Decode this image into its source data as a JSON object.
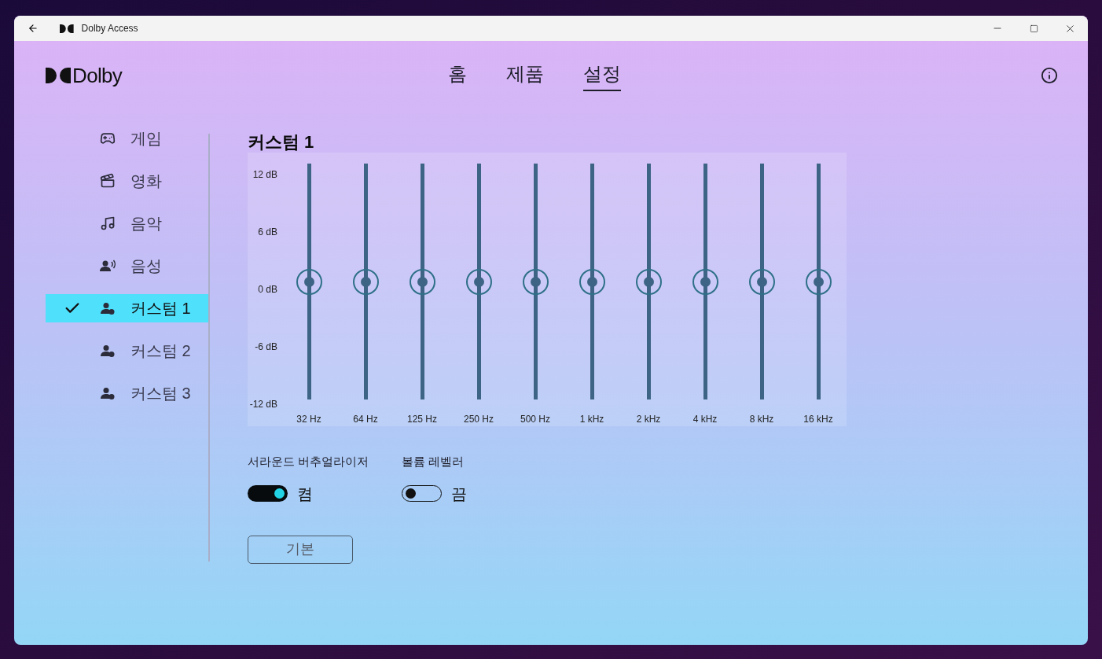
{
  "window": {
    "title": "Dolby Access"
  },
  "logo": {
    "text": "Dolby"
  },
  "nav": [
    {
      "label": "홈",
      "selected": false
    },
    {
      "label": "제품",
      "selected": false
    },
    {
      "label": "설정",
      "selected": true
    }
  ],
  "sidebar": {
    "items": [
      {
        "kind": "game",
        "label": "게임",
        "selected": false
      },
      {
        "kind": "movie",
        "label": "영화",
        "selected": false
      },
      {
        "kind": "music",
        "label": "음악",
        "selected": false
      },
      {
        "kind": "voice",
        "label": "음성",
        "selected": false
      },
      {
        "kind": "custom",
        "label": "커스텀 1",
        "selected": true
      },
      {
        "kind": "custom",
        "label": "커스텀 2",
        "selected": false
      },
      {
        "kind": "custom",
        "label": "커스텀 3",
        "selected": false
      }
    ]
  },
  "equalizer": {
    "title": "커스텀 1",
    "scale": [
      "12 dB",
      "6 dB",
      "0 dB",
      "-6 dB",
      "-12 dB"
    ],
    "bands": [
      {
        "label": "32 Hz",
        "level": 0.5
      },
      {
        "label": "64 Hz",
        "level": 0.5
      },
      {
        "label": "125 Hz",
        "level": 0.5
      },
      {
        "label": "250 Hz",
        "level": 0.5
      },
      {
        "label": "500 Hz",
        "level": 0.5
      },
      {
        "label": "1 kHz",
        "level": 0.5
      },
      {
        "label": "2 kHz",
        "level": 0.5
      },
      {
        "label": "4 kHz",
        "level": 0.5
      },
      {
        "label": "8 kHz",
        "level": 0.5
      },
      {
        "label": "16 kHz",
        "level": 0.5
      }
    ]
  },
  "toggles": [
    {
      "label": "서라운드 버추얼라이저",
      "on": true,
      "state_text": "켬"
    },
    {
      "label": "볼륨 레벨러",
      "on": false,
      "state_text": "끔"
    }
  ],
  "reset_button": {
    "label": "기본"
  }
}
